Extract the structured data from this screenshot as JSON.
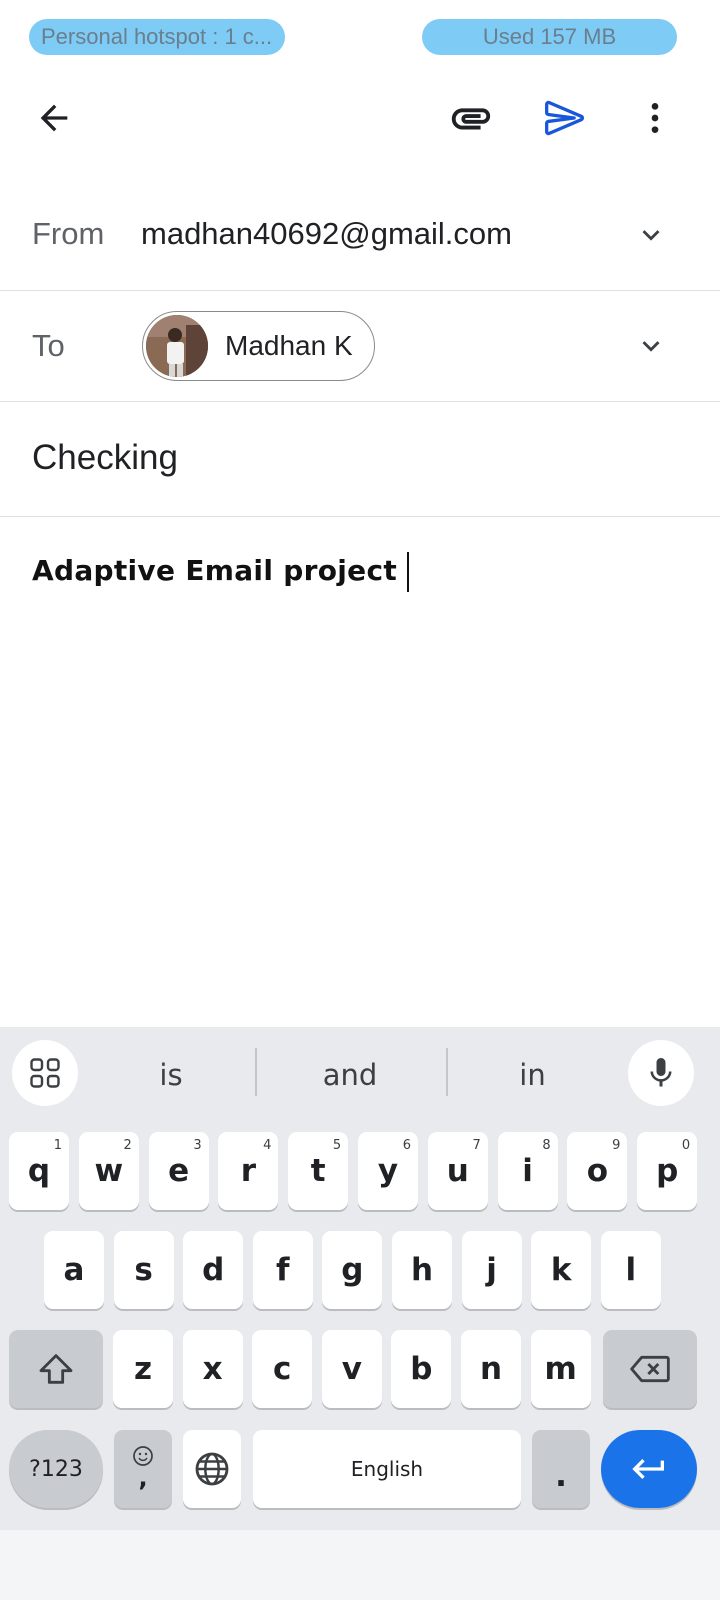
{
  "status_bar": {
    "hotspot_text": "Personal hotspot : 1 c...",
    "usage_text": "Used  157 MB"
  },
  "app_bar": {
    "back_icon": "arrow-back-icon",
    "attach_icon": "paperclip-icon",
    "send_icon": "send-icon",
    "more_icon": "more-vert-icon",
    "send_color": "#1a56db"
  },
  "compose": {
    "from_label": "From",
    "from_value": "madhan40692@gmail.com",
    "to_label": "To",
    "to_chip_name": "Madhan K",
    "subject": "Checking",
    "body": "Adaptive Email project"
  },
  "keyboard": {
    "suggestions": [
      "is",
      "and",
      "in"
    ],
    "row1": [
      {
        "key": "q",
        "hint": "1"
      },
      {
        "key": "w",
        "hint": "2"
      },
      {
        "key": "e",
        "hint": "3"
      },
      {
        "key": "r",
        "hint": "4"
      },
      {
        "key": "t",
        "hint": "5"
      },
      {
        "key": "y",
        "hint": "6"
      },
      {
        "key": "u",
        "hint": "7"
      },
      {
        "key": "i",
        "hint": "8"
      },
      {
        "key": "o",
        "hint": "9"
      },
      {
        "key": "p",
        "hint": "0"
      }
    ],
    "row2": [
      "a",
      "s",
      "d",
      "f",
      "g",
      "h",
      "j",
      "k",
      "l"
    ],
    "row3": [
      "z",
      "x",
      "c",
      "v",
      "b",
      "n",
      "m"
    ],
    "symbols_label": "?123",
    "emoji_comma_label": ",",
    "space_label": "English",
    "period_label": ".",
    "accent_color": "#1a73e8"
  }
}
